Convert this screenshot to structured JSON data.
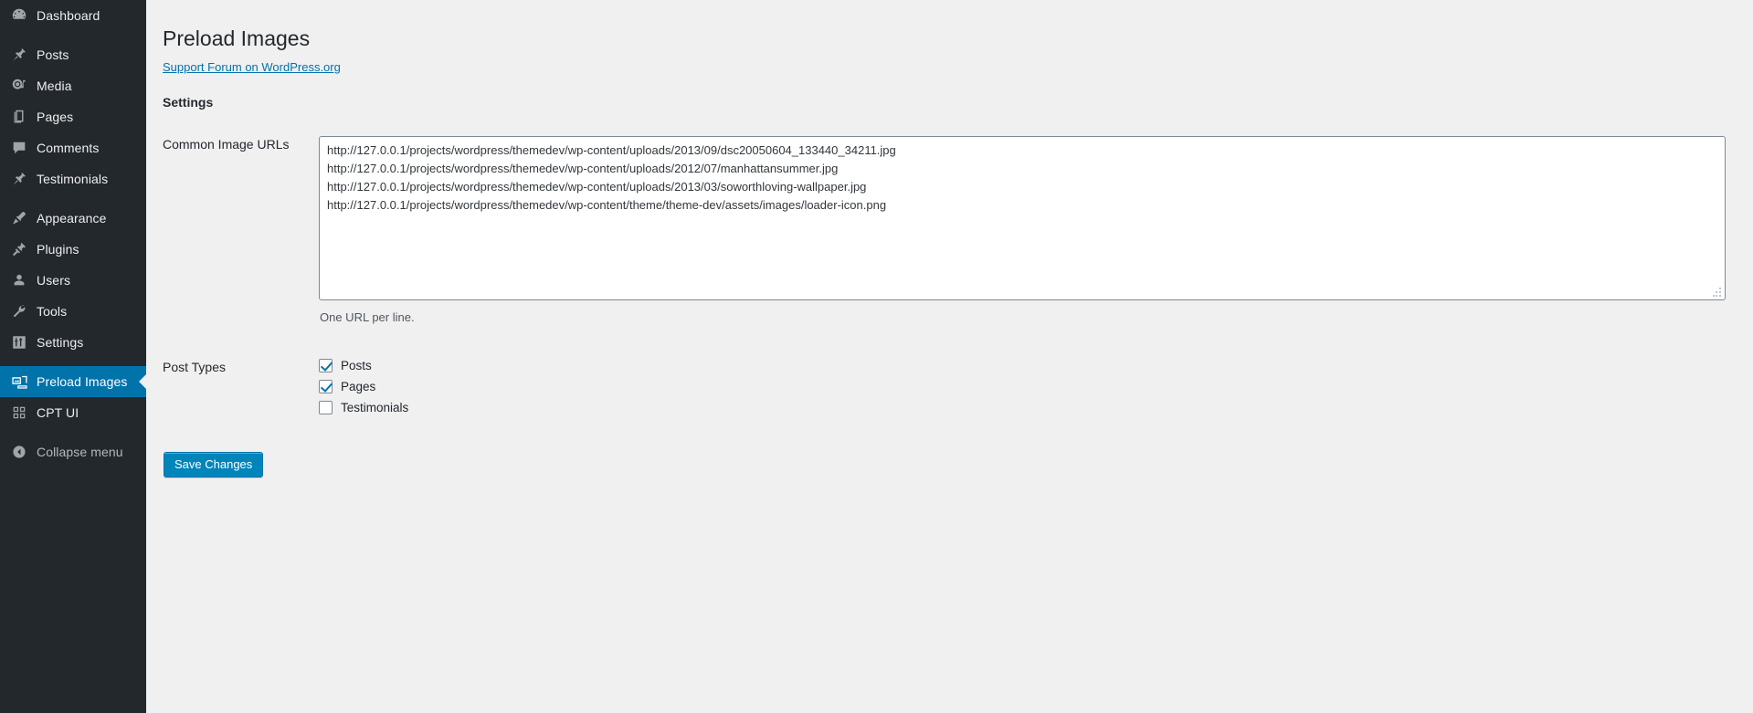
{
  "sidebar": {
    "collapse_icon": "chevron-left-circle-icon",
    "items": [
      {
        "label": "Dashboard",
        "icon": "dashboard-icon",
        "current": false,
        "sep_after": true
      },
      {
        "label": "Posts",
        "icon": "pin-icon",
        "current": false,
        "sep_after": false
      },
      {
        "label": "Media",
        "icon": "media-icon",
        "current": false,
        "sep_after": false
      },
      {
        "label": "Pages",
        "icon": "pages-icon",
        "current": false,
        "sep_after": false
      },
      {
        "label": "Comments",
        "icon": "comments-icon",
        "current": false,
        "sep_after": false
      },
      {
        "label": "Testimonials",
        "icon": "pin-icon",
        "current": false,
        "sep_after": true
      },
      {
        "label": "Appearance",
        "icon": "appearance-brush-icon",
        "current": false,
        "sep_after": false
      },
      {
        "label": "Plugins",
        "icon": "plugin-plug-icon",
        "current": false,
        "sep_after": false
      },
      {
        "label": "Users",
        "icon": "user-icon",
        "current": false,
        "sep_after": false
      },
      {
        "label": "Tools",
        "icon": "wrench-icon",
        "current": false,
        "sep_after": false
      },
      {
        "label": "Settings",
        "icon": "sliders-icon",
        "current": false,
        "sep_after": true
      },
      {
        "label": "Preload Images",
        "icon": "images-stack-icon",
        "current": true,
        "sep_after": false
      },
      {
        "label": "CPT UI",
        "icon": "grid-blocks-icon",
        "current": false,
        "sep_after": true
      },
      {
        "label": "Collapse menu",
        "icon": "chevron-left-circle-icon",
        "current": false,
        "sep_after": false
      }
    ]
  },
  "page": {
    "title": "Preload Images",
    "support_link": "Support Forum on WordPress.org",
    "settings_heading": "Settings"
  },
  "form": {
    "urls_label": "Common Image URLs",
    "urls_value": "http://127.0.0.1/projects/wordpress/themedev/wp-content/uploads/2013/09/dsc20050604_133440_34211.jpg\nhttp://127.0.0.1/projects/wordpress/themedev/wp-content/uploads/2012/07/manhattansummer.jpg\nhttp://127.0.0.1/projects/wordpress/themedev/wp-content/uploads/2013/03/soworthloving-wallpaper.jpg\nhttp://127.0.0.1/projects/wordpress/themedev/wp-content/theme/theme-dev/assets/images/loader-icon.png",
    "urls_placeholder": "",
    "urls_description": "One URL per line.",
    "post_types_label": "Post Types",
    "post_types": [
      {
        "label": "Posts",
        "checked": true
      },
      {
        "label": "Pages",
        "checked": true
      },
      {
        "label": "Testimonials",
        "checked": false
      }
    ],
    "save_label": "Save Changes"
  },
  "colors": {
    "sidebar_bg": "#23282d",
    "accent": "#0073aa",
    "button_bg": "#0085ba",
    "content_bg": "#f0f0f1",
    "link": "#0073aa"
  }
}
